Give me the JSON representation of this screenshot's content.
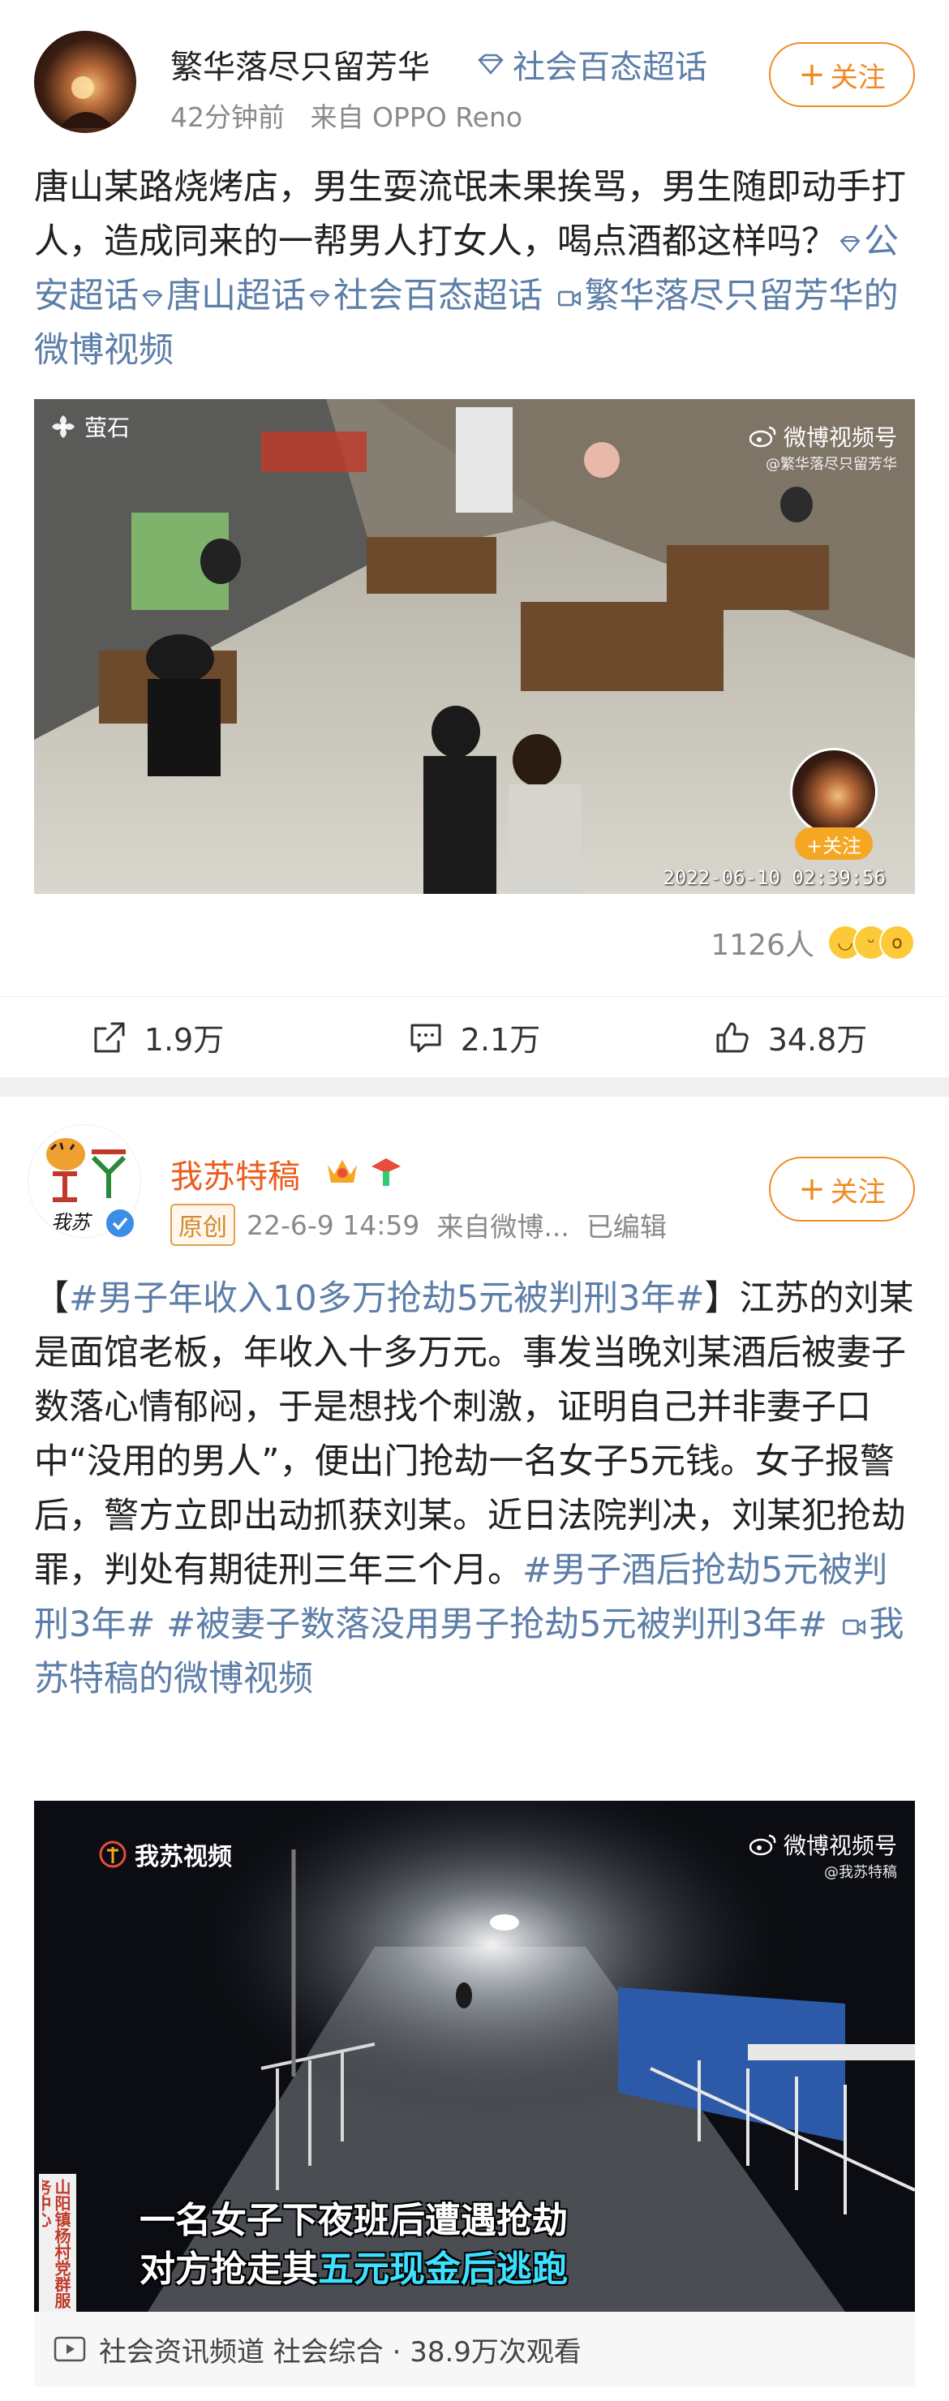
{
  "post1": {
    "username": "繁华落尽只留芳华",
    "topic_chip": "社会百态超话",
    "time": "42分钟前",
    "source": "来自 OPPO Reno",
    "follow_label": "关注",
    "text": "唐山某路烧烤店，男生耍流氓未果挨骂，男生随即动手打人，造成同来的一帮男人打女人，喝点酒都这样吗？",
    "topics": [
      "公安超话",
      "唐山超话",
      "社会百态超话"
    ],
    "video_link": "繁华落尽只留芳华的微博视频",
    "video": {
      "brand": "萤石",
      "watermark_title": "微博视频号",
      "watermark_sub": "@繁华落尽只留芳华",
      "timestamp": "2022-06-10 02:39:56",
      "overlay_follow": "+关注"
    },
    "reaction_count": "1126人",
    "share_count": "1.9万",
    "comment_count": "2.1万",
    "like_count": "34.8万"
  },
  "post2": {
    "username": "我苏特稿",
    "avatar_label": "我苏",
    "original_badge": "原创",
    "time": "22-6-9 14:59",
    "source": "来自微博...",
    "edited": "已编辑",
    "follow_label": "关注",
    "hashtag_main": "#男子年收入10多万抢劫5元被判刑3年#",
    "text": "江苏的刘某是面馆老板，年收入十多万元。事发当晚刘某酒后被妻子数落心情郁闷，于是想找个刺激，证明自己并非妻子口中“没用的男人”，便出门抢劫一名女子5元钱。女子报警后，警方立即出动抓获刘某。近日法院判决，刘某犯抢劫罪，判处有期徒刑三年三个月。",
    "hashtag2": "#男子酒后抢劫5元被判刑3年#",
    "hashtag3": "#被妻子数落没用男子抢劫5元被判刑3年#",
    "video_link": "我苏特稿的微博视频",
    "video": {
      "brand": "我苏视频",
      "watermark_title": "微博视频号",
      "watermark_sub": "@我苏特稿",
      "caption_line1": "一名女子下夜班后遭遇抢劫",
      "caption_line2_a": "对方抢走其",
      "caption_line2_b": "五元现金后逃跑",
      "sign_text": "山阳镇杨村党群服务中心"
    },
    "footer": "社会资讯频道 社会综合 · 38.9万次观看"
  },
  "colors": {
    "link": "#5d7ea8",
    "accent_orange": "#f08a24",
    "username_orange": "#ea5d1c",
    "caption_highlight": "#3ee0ff"
  }
}
